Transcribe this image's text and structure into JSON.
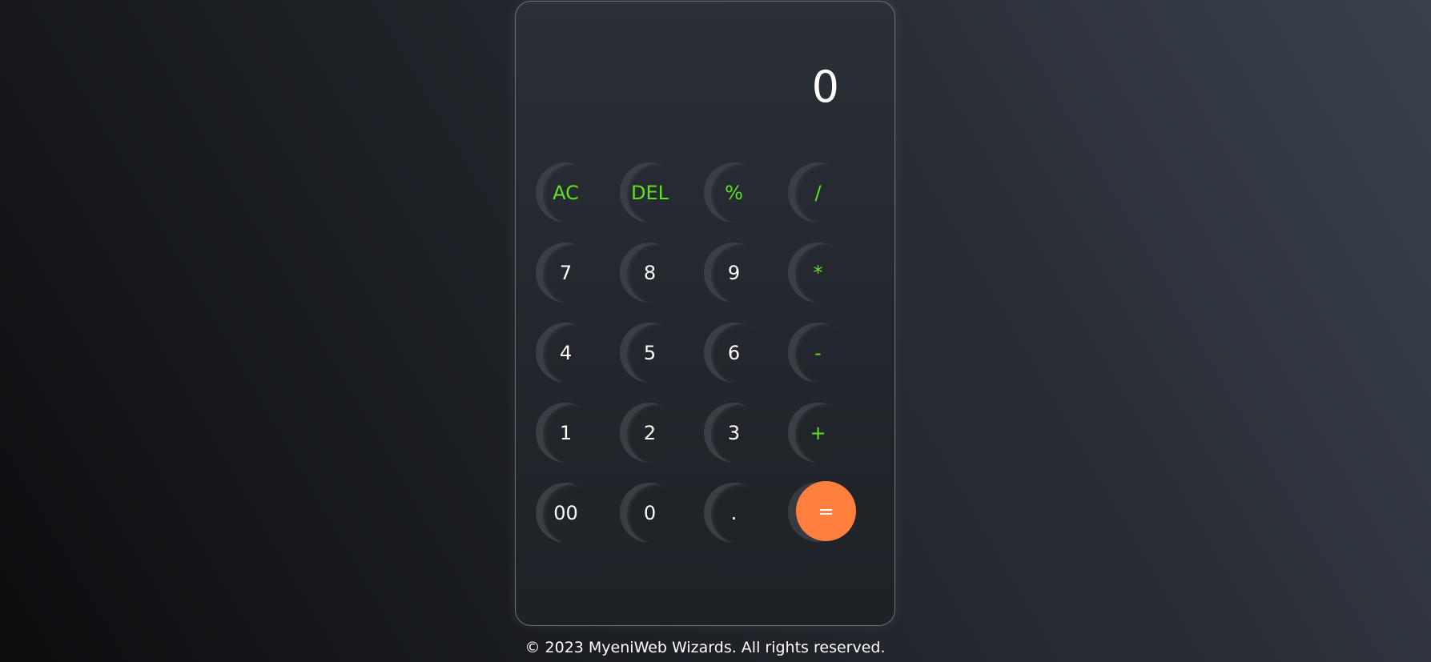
{
  "display": {
    "value": "0"
  },
  "keys": [
    {
      "label": "AC",
      "name": "clear-all-button",
      "kind": "op"
    },
    {
      "label": "DEL",
      "name": "delete-button",
      "kind": "op"
    },
    {
      "label": "%",
      "name": "percent-button",
      "kind": "op"
    },
    {
      "label": "/",
      "name": "divide-button",
      "kind": "op"
    },
    {
      "label": "7",
      "name": "digit-7-button",
      "kind": "num"
    },
    {
      "label": "8",
      "name": "digit-8-button",
      "kind": "num"
    },
    {
      "label": "9",
      "name": "digit-9-button",
      "kind": "num"
    },
    {
      "label": "*",
      "name": "multiply-button",
      "kind": "op"
    },
    {
      "label": "4",
      "name": "digit-4-button",
      "kind": "num"
    },
    {
      "label": "5",
      "name": "digit-5-button",
      "kind": "num"
    },
    {
      "label": "6",
      "name": "digit-6-button",
      "kind": "num"
    },
    {
      "label": "-",
      "name": "subtract-button",
      "kind": "op"
    },
    {
      "label": "1",
      "name": "digit-1-button",
      "kind": "num"
    },
    {
      "label": "2",
      "name": "digit-2-button",
      "kind": "num"
    },
    {
      "label": "3",
      "name": "digit-3-button",
      "kind": "num"
    },
    {
      "label": "+",
      "name": "add-button",
      "kind": "op"
    },
    {
      "label": "00",
      "name": "double-zero-button",
      "kind": "num"
    },
    {
      "label": "0",
      "name": "digit-0-button",
      "kind": "num"
    },
    {
      "label": ".",
      "name": "decimal-button",
      "kind": "num"
    },
    {
      "label": "=",
      "name": "equals-button",
      "kind": "equals"
    }
  ],
  "colors": {
    "operator_text": "#5fe11c",
    "equals_background": "#ff7f3e",
    "digit_text": "#ffffff"
  },
  "footer": {
    "text": "© 2023 MyeniWeb Wizards. All rights reserved."
  }
}
